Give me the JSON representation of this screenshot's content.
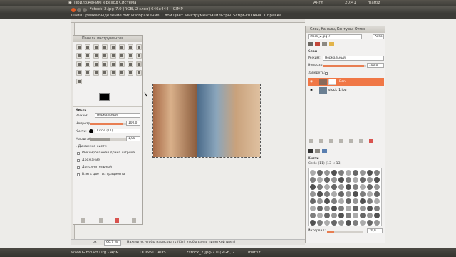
{
  "top_panel": {
    "apps": "Приложения",
    "places": "Переход",
    "system": "Система",
    "keyboard": "Англ",
    "time": "20:41",
    "user": "mattiz"
  },
  "window_title": "*stock_2.jpg-7.0 (RGB, 2 слоя) 646x444 – GIMP",
  "menu": [
    "Файл",
    "Правка",
    "Выделение",
    "Вид",
    "Изображение",
    "Слой",
    "Цвет",
    "Инструменты",
    "Фильтры",
    "Script-Fu",
    "Окна",
    "Справка"
  ],
  "toolbox": {
    "title": "Панель инструментов",
    "tool_name": "Кисть",
    "mode_label": "Режим:",
    "mode_value": "Нормальный",
    "opacity_label": "Непрозр.",
    "opacity_value": "100,0",
    "brush_label": "Кисть:",
    "brush_value": "Circle (11)",
    "scale_label": "Масштаб:",
    "scale_value": "1,00",
    "dynamics": "Динамика кисти",
    "opt1": "Фиксированная длина штриха",
    "opt2": "Дрожание",
    "opt3": "Дополнительный",
    "opt4": "Взять цвет из градиента"
  },
  "layers": {
    "title": "Слои, Каналы, Контуры, Отмен",
    "image": "stock_2.jpg-7",
    "section": "Слои",
    "mode_label": "Режим:",
    "mode_value": "Нормальный",
    "opacity_label": "Непрозр.",
    "opacity_value": "100,0",
    "lock_label": "Запереть:",
    "layer1": "Bon",
    "layer2": "stock_1.jpg",
    "brushes_section": "Кисти",
    "brush_name": "Circle (11) (13 × 13)",
    "spacing_label": "Интервал:",
    "spacing_value": "20,0"
  },
  "status": {
    "unit": "px",
    "zoom": "66,7 %",
    "message": "Нажмите, чтобы нарисовать (Ctrl, чтобы взять пипеткой цвет)"
  },
  "taskbar": [
    "www.GimpArt.Org - Адм...",
    "DOWNLOADS",
    "*stock_2.jpg-7.0 (RGB, 2...",
    "mattiz"
  ]
}
